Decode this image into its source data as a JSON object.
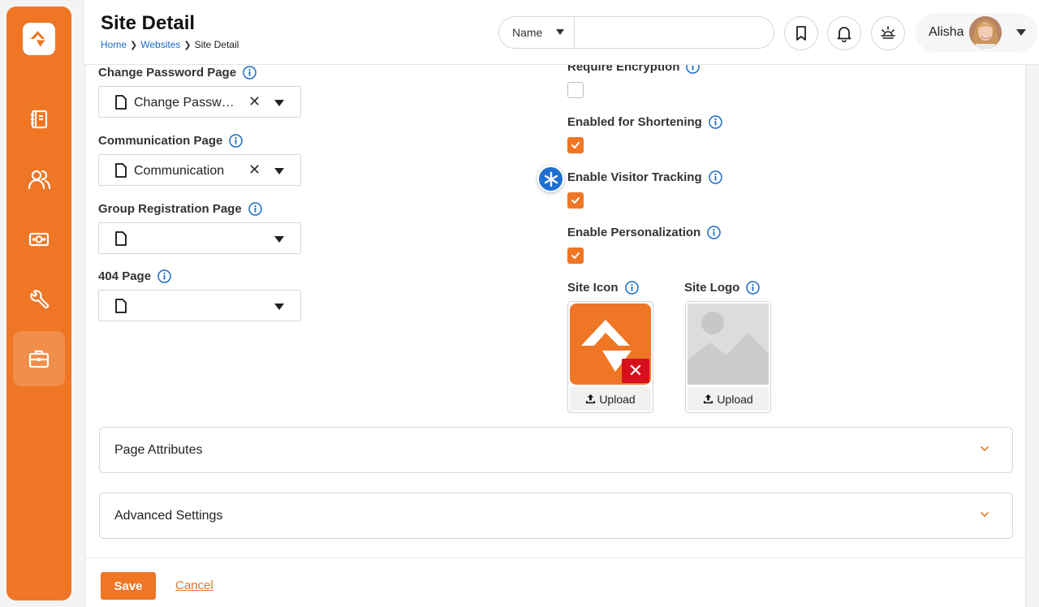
{
  "header": {
    "title": "Site Detail",
    "breadcrumb": [
      "Home",
      "Websites",
      "Site Detail"
    ],
    "search": {
      "scope": "Name",
      "value": "",
      "placeholder": ""
    },
    "user": {
      "name": "Alisha"
    }
  },
  "sidebar": {
    "items": [
      {
        "icon": "notebook-icon"
      },
      {
        "icon": "people-icon"
      },
      {
        "icon": "money-icon"
      },
      {
        "icon": "wrench-icon"
      },
      {
        "icon": "briefcase-icon",
        "active": true
      }
    ]
  },
  "left_fields": [
    {
      "label": "Change Password Page",
      "value": "Change Passwor...",
      "clearable": true
    },
    {
      "label": "Communication Page",
      "value": "Communication",
      "clearable": true
    },
    {
      "label": "Group Registration Page",
      "value": "",
      "clearable": false
    },
    {
      "label": "404 Page",
      "value": "",
      "clearable": false
    }
  ],
  "right_fields": [
    {
      "label": "Require Encryption",
      "checked": false
    },
    {
      "label": "Enabled for Shortening",
      "checked": true
    },
    {
      "label": "Enable Visitor Tracking",
      "checked": true
    },
    {
      "label": "Enable Personalization",
      "checked": true
    }
  ],
  "images": {
    "site_icon": {
      "label": "Site Icon",
      "upload": "Upload"
    },
    "site_logo": {
      "label": "Site Logo",
      "upload": "Upload"
    }
  },
  "panels": [
    {
      "title": "Page Attributes"
    },
    {
      "title": "Advanced Settings"
    }
  ],
  "footer": {
    "save": "Save",
    "cancel": "Cancel"
  },
  "colors": {
    "accent": "#ee7625",
    "link": "#1a6cc7",
    "danger": "#d6111d"
  }
}
